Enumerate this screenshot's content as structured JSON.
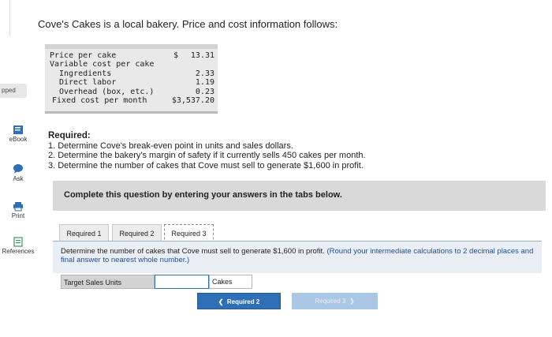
{
  "sidebar": {
    "dropped_tab": "pped",
    "items": [
      {
        "label": "eBook",
        "icon": "book-icon"
      },
      {
        "label": "Ask",
        "icon": "chat-bubble-icon"
      },
      {
        "label": "Print",
        "icon": "printer-icon"
      },
      {
        "label": "References",
        "icon": "references-icon"
      }
    ]
  },
  "intro": "Cove's Cakes is a local bakery. Price and cost information follows:",
  "cost_table": {
    "rows": [
      {
        "label": "Price per cake",
        "dollar": "$",
        "value": "13.31"
      },
      {
        "label": "Variable cost per cake",
        "dollar": "",
        "value": ""
      },
      {
        "label": "Ingredients",
        "dollar": "",
        "value": "2.33"
      },
      {
        "label": "Direct labor",
        "dollar": "",
        "value": "1.19"
      },
      {
        "label": "Overhead (box, etc.)",
        "dollar": "",
        "value": "0.23"
      },
      {
        "label": "Fixed cost per month",
        "dollar": "",
        "value": "$3,537.20"
      }
    ]
  },
  "required": {
    "heading": "Required:",
    "items": [
      "1. Determine Cove's break-even point in units and sales dollars.",
      "2. Determine the bakery's margin of safety if it currently sells 450 cakes per month.",
      "3. Determine the number of cakes that Cove must sell to generate $1,600 in profit."
    ]
  },
  "instructions": "Complete this question by entering your answers in the tabs below.",
  "tabs": [
    "Required 1",
    "Required 2",
    "Required 3"
  ],
  "active_tab": "Required 3",
  "panel": {
    "text": "Determine the number of cakes that Cove must sell to generate $1,600 in profit.",
    "note": "(Round your intermediate calculations to 2 decimal places and final answer to nearest whole number.)"
  },
  "answer": {
    "label": "Target Sales Units",
    "value": "",
    "unit": "Cakes"
  },
  "nav": {
    "prev": "Required 2",
    "next": "Required 3"
  },
  "colors": {
    "accent": "#2f6fb6",
    "panel_bg": "#e9eef4",
    "note_blue": "#1f4f9a"
  }
}
